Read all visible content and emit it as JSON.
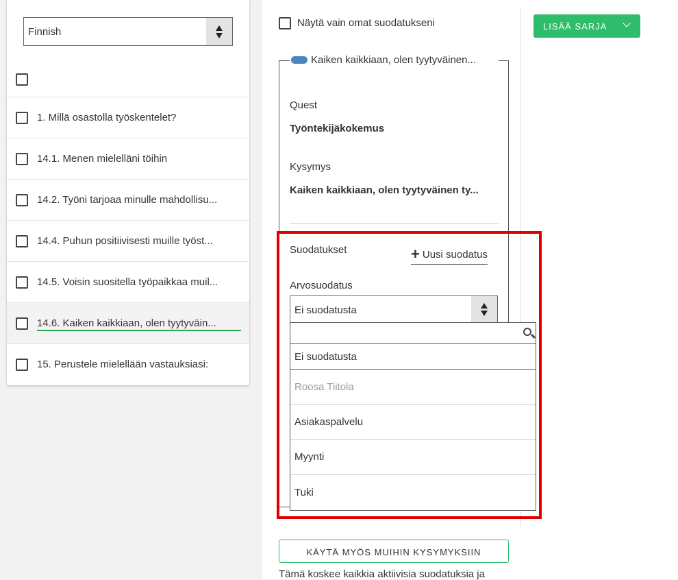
{
  "language_select": {
    "value": "Finnish"
  },
  "questions": [
    {
      "label": "1.  Millä osastolla työskentelet?"
    },
    {
      "label": "14.1.  Menen mielelläni töihin"
    },
    {
      "label": "14.2.  Työni tarjoaa minulle mahdollisu..."
    },
    {
      "label": "14.4.  Puhun positiivisesti muille työst..."
    },
    {
      "label": "14.5.  Voisin suositella työpaikkaa muil..."
    },
    {
      "label": "14.6.  Kaiken kaikkiaan, olen tyytyväin..."
    },
    {
      "label": "15.  Perustele mielellään vastauksiasi:"
    }
  ],
  "own_filters_label": "Näytä vain omat suodatukseni",
  "add_series_button": "LISÄÄ SARJA",
  "series": {
    "legend": "Kaiken kaikkiaan, olen tyytyväinen...",
    "legend_color": "#4a86c2",
    "quest_label": "Quest",
    "quest_value": "Työntekijäkokemus",
    "question_label": "Kysymys",
    "question_value": "Kaiken kaikkiaan, olen tyytyväinen ty...",
    "filters_label": "Suodatukset",
    "new_filter_label": "Uusi suodatus",
    "value_filter_label": "Arvosuodatus",
    "value_filter_selected": "Ei suodatusta"
  },
  "dropdown": {
    "options": [
      "Ei suodatusta",
      "Roosa Tiitola",
      "Asiakaspalvelu",
      "Myynti",
      "Tuki"
    ]
  },
  "apply_button": "KÄYTÄ MYÖS MUIHIN KYSYMYKSIIN",
  "bottom_note": "Tämä koskee kaikkia aktiivisia suodatuksia ja",
  "colors": {
    "accent_green": "#2ebd6b",
    "highlight_red": "#e00000"
  }
}
